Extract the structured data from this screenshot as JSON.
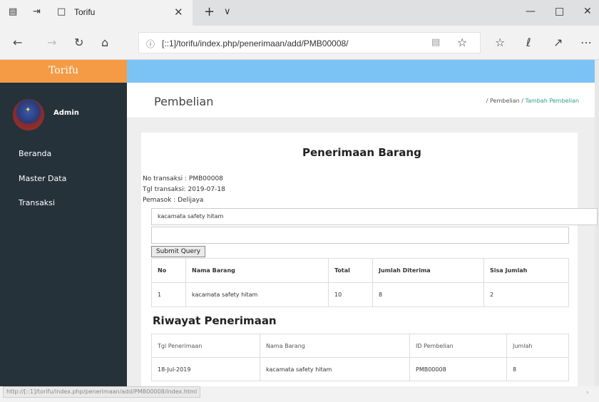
{
  "browser": {
    "tab_title": "Torifu",
    "url": "[::1]/torifu/index.php/penerimaan/add/PMB00008/",
    "status_url": "http://[::1]/torifu/index.php/penerimaan/add/PMB00008/index.html"
  },
  "app": {
    "brand": "Torifu",
    "user": "Admin",
    "menu": [
      "Beranda",
      "Master Data",
      "Transaksi"
    ]
  },
  "header": {
    "title": "Pembelian",
    "breadcrumb": [
      "Pembelian",
      "Tambah Pembelian"
    ]
  },
  "form": {
    "heading": "Penerimaan Barang",
    "no_transaksi": "No transaksi : PMB00008",
    "tgl_transaksi": "Tgl transaksi: 2019-07-18",
    "pemasok": "Pemasok : Delijaya",
    "item_value": "kacamata safety hitam",
    "qty_value": "",
    "submit_label": "Submit Query"
  },
  "items_table": {
    "headers": [
      "No",
      "Nama Barang",
      "Total",
      "Jumlah Diterima",
      "Sisa Jumlah"
    ],
    "rows": [
      [
        "1",
        "kacamata safety hitam",
        "10",
        "8",
        "2"
      ]
    ]
  },
  "history": {
    "heading": "Riwayat Penerimaan",
    "headers": [
      "Tgl Penerimaan",
      "Nama Barang",
      "ID Pembelian",
      "Jumlah"
    ],
    "rows": [
      [
        "18-Jul-2019",
        "kacamata safety hitam",
        "PMB00008",
        "8"
      ]
    ]
  },
  "colors": {
    "sidebar": "#26323a",
    "brand": "#f59b45",
    "topbar": "#7cc3f5",
    "breadcrumb_active": "#2a9d8f"
  }
}
